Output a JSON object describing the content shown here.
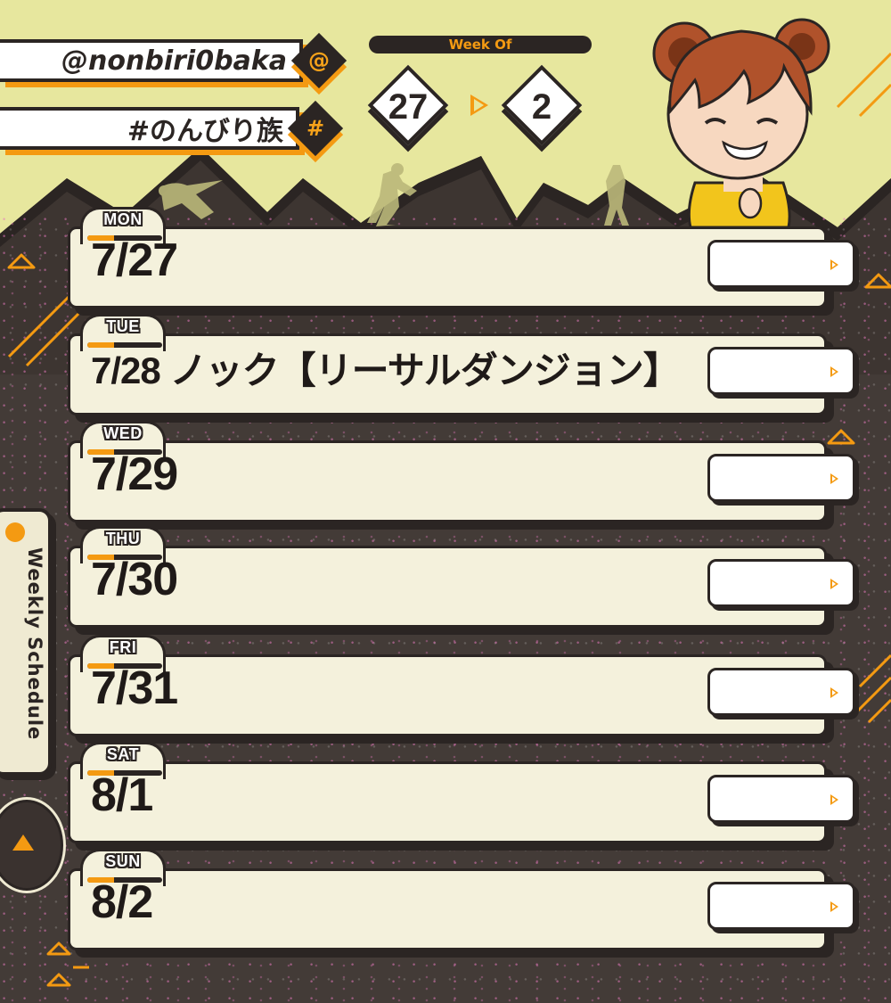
{
  "header": {
    "handle": "@nonbiri0baka",
    "handle_badge": "@",
    "hashtag": "#のんびり族",
    "hashtag_badge": "#"
  },
  "week": {
    "label": "Week Of",
    "start": "27",
    "end": "2"
  },
  "sidebar": {
    "label": "Weekly Schedule"
  },
  "days": [
    {
      "day": "MON",
      "text": "7/27"
    },
    {
      "day": "TUE",
      "text": "7/28 ノック【リーサルダンジョン】"
    },
    {
      "day": "WED",
      "text": "7/29"
    },
    {
      "day": "THU",
      "text": "7/30"
    },
    {
      "day": "FRI",
      "text": "7/31"
    },
    {
      "day": "SAT",
      "text": "8/1"
    },
    {
      "day": "SUN",
      "text": "8/2"
    }
  ],
  "colors": {
    "accent": "#f49a12",
    "dark": "#2b2523",
    "sky": "#e7e79e",
    "card": "#f4f1dc"
  }
}
